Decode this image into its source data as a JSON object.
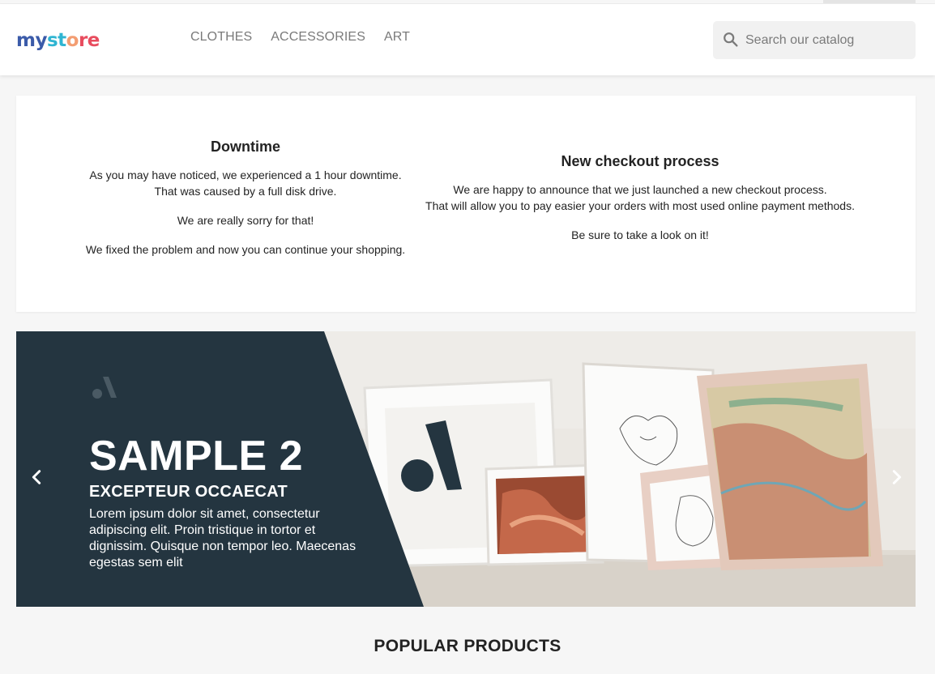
{
  "store": {
    "logo_parts": [
      {
        "text": "my ",
        "color": "#3b5ba9"
      },
      {
        "text": "st",
        "color": "#2fb5d2"
      },
      {
        "text": "o",
        "color": "#f39d72"
      },
      {
        "text": "re",
        "color": "#e84c5e"
      }
    ]
  },
  "nav": {
    "items": [
      {
        "label": "CLOTHES"
      },
      {
        "label": "ACCESSORIES"
      },
      {
        "label": "ART"
      }
    ]
  },
  "search": {
    "placeholder": "Search our catalog",
    "value": "",
    "icon": "search-icon"
  },
  "notices": {
    "downtime": {
      "title": "Downtime",
      "lines1": [
        "As you may have noticed, we experienced a 1 hour downtime.",
        "That was caused by a full disk drive."
      ],
      "line2": "We are really sorry for that!",
      "line3": "We fixed the problem and now you can continue your shopping."
    },
    "checkout": {
      "title": "New checkout process",
      "lines1": [
        "We are happy to announce that we just launched a new checkout process.",
        "That will allow you to pay easier your orders with most used online payment methods."
      ],
      "line2": "Be sure to take a look on it!"
    }
  },
  "slider": {
    "title": "SAMPLE 2",
    "subtitle": "EXCEPTEUR OCCAECAT",
    "text": "Lorem ipsum dolor sit amet, consectetur adipiscing elit. Proin tristique in tortor et dignissim. Quisque non tempor leo. Maecenas egestas sem elit",
    "prev_icon": "chevron-left-icon",
    "next_icon": "chevron-right-icon",
    "panel_color": "#243540"
  },
  "sections": {
    "popular_title": "POPULAR PRODUCTS"
  }
}
